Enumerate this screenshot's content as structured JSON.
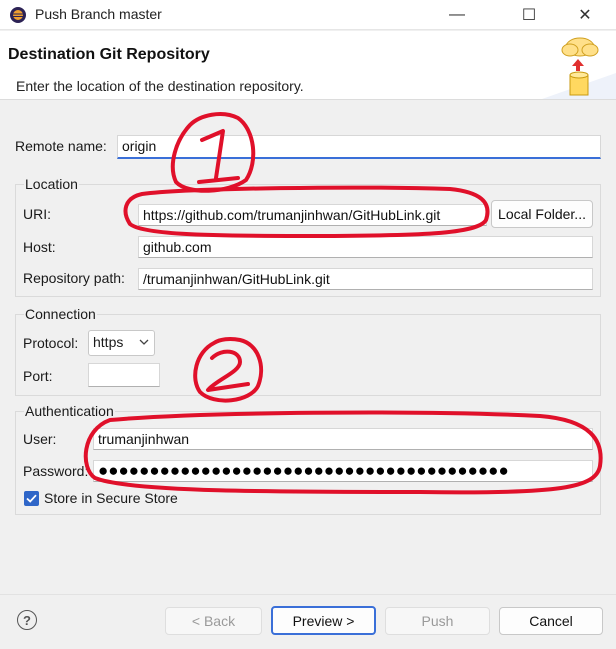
{
  "window": {
    "title": "Push Branch master",
    "minimize_glyph": "—",
    "maximize_glyph": "☐",
    "close_glyph": "✕"
  },
  "header": {
    "title": "Destination Git Repository",
    "description": "Enter the location of the destination repository."
  },
  "form": {
    "remote_name_label": "Remote name:",
    "remote_name_value": "origin",
    "location": {
      "group_title": "Location",
      "uri_label": "URI:",
      "uri_value": "https://github.com/trumanjinhwan/GitHubLink.git",
      "local_folder_button": "Local Folder...",
      "host_label": "Host:",
      "host_value": "github.com",
      "repo_path_label": "Repository path:",
      "repo_path_value": "/trumanjinhwan/GitHubLink.git"
    },
    "connection": {
      "group_title": "Connection",
      "protocol_label": "Protocol:",
      "protocol_value": "https",
      "port_label": "Port:",
      "port_value": ""
    },
    "authentication": {
      "group_title": "Authentication",
      "user_label": "User:",
      "user_value": "trumanjinhwan",
      "password_label": "Password:",
      "password_value": "●●●●●●●●●●●●●●●●●●●●●●●●●●●●●●●●●●●●●●●●",
      "store_label": "Store in Secure Store",
      "store_checked": true
    }
  },
  "buttons": {
    "back": "< Back",
    "preview": "Preview >",
    "push": "Push",
    "cancel": "Cancel",
    "help_glyph": "?"
  },
  "colors": {
    "accent": "#3a6fd8",
    "annotation": "#e0102a"
  },
  "icons": [
    "eclipse-app-icon",
    "cloud-push-database-icon",
    "chevron-down-icon",
    "checkmark-icon",
    "help-icon"
  ]
}
